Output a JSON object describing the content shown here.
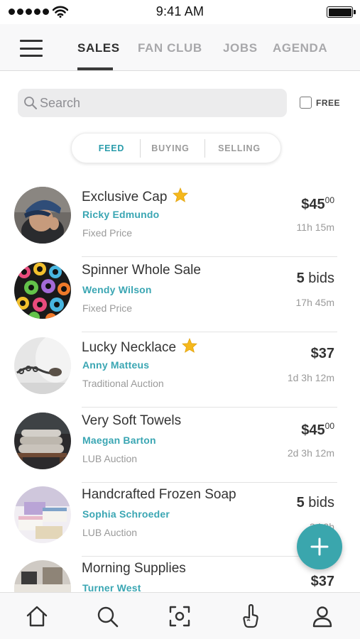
{
  "status_bar": {
    "time": "9:41 AM"
  },
  "header": {
    "tabs": [
      {
        "label": "SALES",
        "active": true
      },
      {
        "label": "FAN CLUB",
        "active": false
      },
      {
        "label": "JOBS",
        "active": false
      },
      {
        "label": "AGENDA",
        "active": false
      }
    ]
  },
  "search": {
    "placeholder": "Search",
    "value": ""
  },
  "filter": {
    "free_label": "FREE",
    "free_checked": false
  },
  "segment": {
    "items": [
      {
        "label": "FEED",
        "active": true
      },
      {
        "label": "BUYING",
        "active": false
      },
      {
        "label": "SELLING",
        "active": false
      }
    ]
  },
  "listings": [
    {
      "title": "Exclusive Cap",
      "starred": true,
      "seller": "Ricky Edmundo",
      "type": "Fixed Price",
      "price_main": "$45",
      "price_cents": "00",
      "time_left": "11h 15m"
    },
    {
      "title": "Spinner Whole Sale",
      "starred": false,
      "seller": "Wendy Wilson",
      "type": "Fixed Price",
      "bid_count": "5",
      "bid_word": "bids",
      "time_left": "17h 45m"
    },
    {
      "title": "Lucky Necklace",
      "starred": true,
      "seller": "Anny Matteus",
      "type": "Traditional Auction",
      "price_main": "$37",
      "time_left": "1d 3h 12m"
    },
    {
      "title": "Very Soft Towels",
      "starred": false,
      "seller": "Maegan Barton",
      "type": "LUB Auction",
      "price_main": "$45",
      "price_cents": "00",
      "time_left": "2d 3h 12m"
    },
    {
      "title": "Handcrafted Frozen Soap",
      "starred": false,
      "seller": "Sophia Schroeder",
      "type": "LUB Auction",
      "bid_count": "5",
      "bid_word": "bids",
      "time_left": "3d 3h"
    },
    {
      "title": "Morning Supplies",
      "starred": false,
      "seller": "Turner West",
      "type": "",
      "price_main": "$37",
      "time_left": ""
    }
  ],
  "colors": {
    "accent": "#3aa6b3",
    "fab": "#3aa6ad",
    "star": "#f5b81c",
    "text": "#333333",
    "muted": "#9a9a9a"
  },
  "bottom_nav": {
    "icons": [
      "home-icon",
      "search-icon",
      "scan-icon",
      "foam-finger-icon",
      "profile-icon"
    ]
  },
  "fab": {
    "icon": "plus-icon"
  }
}
